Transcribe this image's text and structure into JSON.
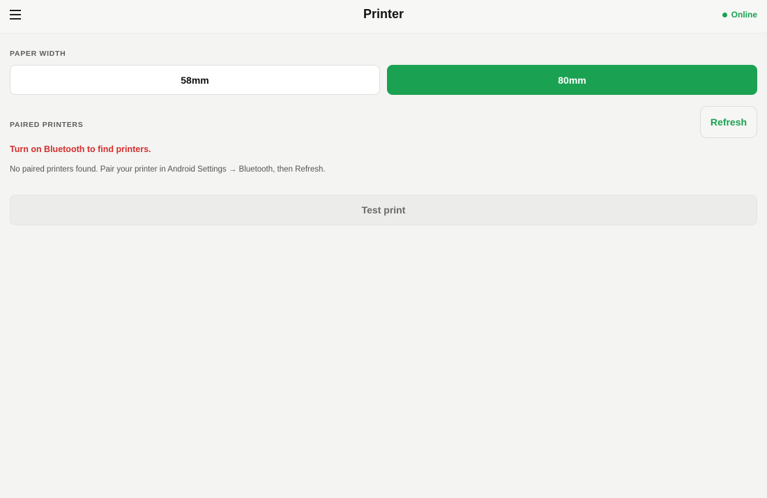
{
  "header": {
    "title": "Printer",
    "status_label": "Online",
    "status_color": "#1aa152"
  },
  "paper_width": {
    "label": "PAPER WIDTH",
    "options": [
      {
        "label": "58mm",
        "selected": false
      },
      {
        "label": "80mm",
        "selected": true
      }
    ],
    "accent_color": "#1aa152"
  },
  "paired_printers": {
    "label": "PAIRED PRINTERS",
    "refresh_label": "Refresh",
    "error_message": "Turn on Bluetooth to find printers.",
    "error_color": "#d32f2f",
    "info_message": "No paired printers found. Pair your printer in Android Settings → Bluetooth, then Refresh."
  },
  "actions": {
    "test_print_label": "Test print"
  },
  "icons": {
    "menu": "menu-icon",
    "status": "status-dot-icon"
  }
}
